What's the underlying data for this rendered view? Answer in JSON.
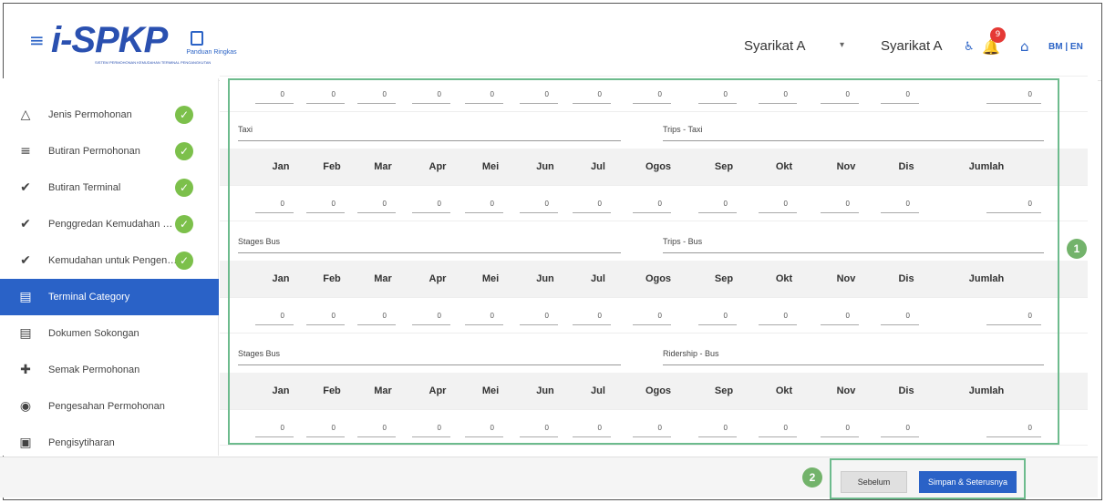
{
  "header": {
    "logo": "i-SPKP",
    "logo_sub": "SISTEM PERMOHONAN KEMUDAHAN TERMINAL PENGANGKUTAN",
    "guide_label": "Panduan Ringkas",
    "company_select": "Syarikat A",
    "company_name": "Syarikat A",
    "notification_count": "9",
    "lang": "BM | EN"
  },
  "sidebar": {
    "items": [
      {
        "label": "Jenis Permohonan",
        "icon": "triangle-icon",
        "glyph": "△",
        "done": true
      },
      {
        "label": "Butiran Permohonan",
        "icon": "filter-icon",
        "glyph": "≡",
        "done": true
      },
      {
        "label": "Butiran Terminal",
        "icon": "check-circle-icon",
        "glyph": "✔",
        "done": true
      },
      {
        "label": "Penggredan Kemudahan Pengangkutan",
        "icon": "check-circle-icon",
        "glyph": "✔",
        "done": true
      },
      {
        "label": "Kemudahan untuk Pengendalian",
        "icon": "check-circle-icon",
        "glyph": "✔",
        "done": true
      },
      {
        "label": "Terminal Category",
        "icon": "document-icon",
        "glyph": "▤",
        "done": false,
        "active": true
      },
      {
        "label": "Dokumen Sokongan",
        "icon": "documents-icon",
        "glyph": "▤",
        "done": false
      },
      {
        "label": "Semak Permohonan",
        "icon": "review-icon",
        "glyph": "✚",
        "done": false
      },
      {
        "label": "Pengesahan Permohonan",
        "icon": "verify-icon",
        "glyph": "◉",
        "done": false
      },
      {
        "label": "Pengisytiharan",
        "icon": "clipboard-icon",
        "glyph": "▣",
        "done": false
      }
    ]
  },
  "months": [
    "Jan",
    "Feb",
    "Mar",
    "Apr",
    "Mei",
    "Jun",
    "Jul",
    "Ogos",
    "Sep",
    "Okt",
    "Nov",
    "Dis",
    "Jumlah"
  ],
  "sections": [
    {
      "category": "Taxi",
      "metric": "Trips - Taxi",
      "values": [
        "0",
        "0",
        "0",
        "0",
        "0",
        "0",
        "0",
        "0",
        "0",
        "0",
        "0",
        "0",
        "0"
      ]
    },
    {
      "category": "Stages Bus",
      "metric": "Trips - Bus",
      "values": [
        "0",
        "0",
        "0",
        "0",
        "0",
        "0",
        "0",
        "0",
        "0",
        "0",
        "0",
        "0",
        "0"
      ]
    },
    {
      "category": "Stages Bus",
      "metric": "Ridership - Bus",
      "values": [
        "0",
        "0",
        "0",
        "0",
        "0",
        "0",
        "0",
        "0",
        "0",
        "0",
        "0",
        "0",
        "0"
      ]
    }
  ],
  "top_values": [
    "0",
    "0",
    "0",
    "0",
    "0",
    "0",
    "0",
    "0",
    "0",
    "0",
    "0",
    "0",
    "0"
  ],
  "callouts": [
    "1",
    "2"
  ],
  "footer": {
    "back_label": "Sebelum",
    "next_label": "Simpan & Seterusnya"
  },
  "colors": {
    "primary": "#2a62c7",
    "success": "#7cc04b",
    "highlight": "#6dbb8d",
    "badge": "#e53935"
  }
}
